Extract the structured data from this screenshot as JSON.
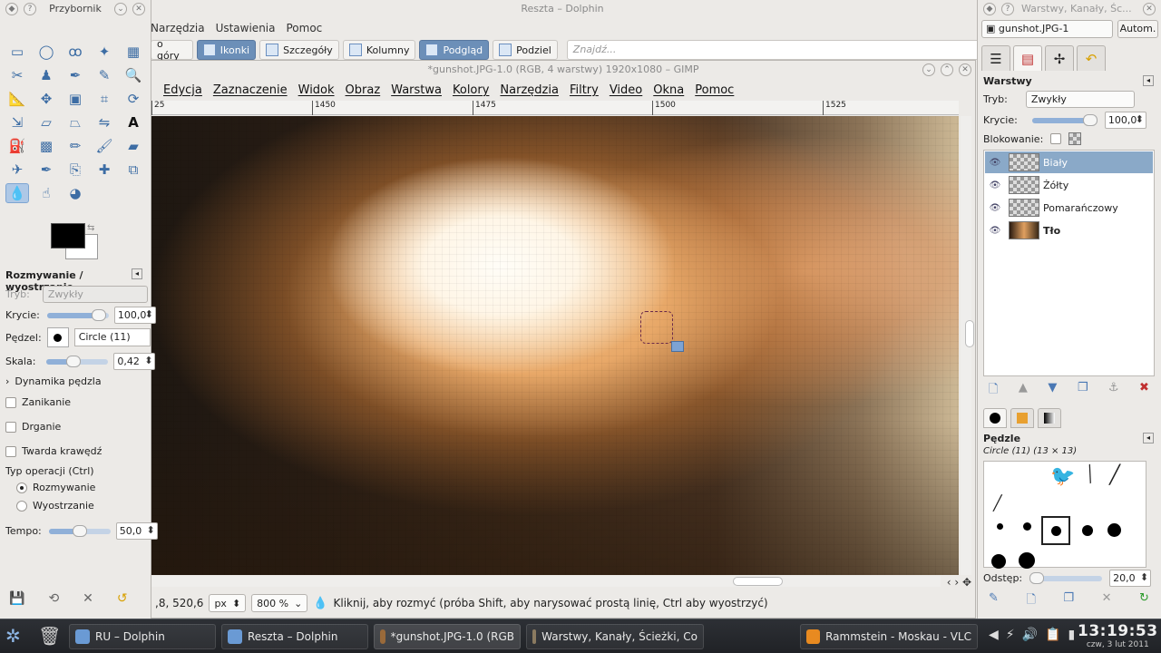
{
  "dolphin": {
    "title": "Reszta – Dolphin",
    "menu": [
      "Narzędzia",
      "Ustawienia",
      "Pomoc"
    ],
    "toolbar": {
      "up": "o góry",
      "icons": "Ikonki",
      "details": "Szczegóły",
      "columns": "Kolumny",
      "preview": "Podgląd",
      "split": "Podziel",
      "search_placeholder": "Znajdź..."
    }
  },
  "gimp": {
    "title": "*gunshot.JPG-1.0 (RGB, 4 warstwy) 1920x1080 – GIMP",
    "menu": [
      "Edycja",
      "Zaznaczenie",
      "Widok",
      "Obraz",
      "Warstwa",
      "Kolory",
      "Narzędzia",
      "Filtry",
      "Video",
      "Okna",
      "Pomoc"
    ],
    "ruler": [
      "25",
      "1450",
      "1475",
      "1500",
      "1525"
    ],
    "status": {
      "coords": ",8, 520,6",
      "unit": "px",
      "zoom": "800 %",
      "message": "Kliknij, aby rozmyć (próba Shift, aby narysować prostą linię, Ctrl aby wyostrzyć)"
    }
  },
  "toolbox": {
    "title": "Przybornik",
    "tools": [
      "rect-select",
      "ellipse-select",
      "free-select",
      "fuzzy-select",
      "color-select",
      "scissors-select",
      "foreground-select",
      "paths",
      "color-picker",
      "zoom",
      "measure",
      "move",
      "align",
      "crop",
      "rotate",
      "scale",
      "shear",
      "perspective",
      "flip",
      "text",
      "bucket-fill",
      "blend",
      "pencil",
      "paintbrush",
      "eraser",
      "airbrush",
      "ink",
      "clone",
      "heal",
      "perspective-clone",
      "blur-sharpen",
      "smudge",
      "dodge-burn"
    ],
    "options_title": "Rozmywanie / wyostrzanie",
    "mode_label": "Tryb:",
    "mode_value": "Zwykły",
    "opacity_label": "Krycie:",
    "opacity_value": "100,0",
    "brush_label": "Pędzel:",
    "brush_value": "Circle (11)",
    "scale_label": "Skala:",
    "scale_value": "0,42",
    "dynamics": "Dynamika pędzla",
    "fade": "Zanikanie",
    "jitter": "Drganie",
    "hard_edge": "Twarda krawędź",
    "op_type": "Typ operacji  (Ctrl)",
    "blur": "Rozmywanie",
    "sharpen": "Wyostrzanie",
    "rate_label": "Tempo:",
    "rate_value": "50,0",
    "opacity_level": 0.95,
    "scale_level": 0.42,
    "rate_level": 0.5
  },
  "dock": {
    "title": "Warstwy, Kanały, Śc...",
    "image": "gunshot.JPG-1",
    "auto": "Autom.",
    "layers_title": "Warstwy",
    "mode_label": "Tryb:",
    "mode_value": "Zwykły",
    "opacity_label": "Krycie:",
    "opacity_value": "100,0",
    "lock_label": "Blokowanie:",
    "layers": [
      "Biały",
      "Żółty",
      "Pomarańczowy",
      "Tło"
    ],
    "brushes_title": "Pędzle",
    "brush_info": "Circle (11) (13 × 13)",
    "spacing_label": "Odstęp:",
    "spacing_value": "20,0"
  },
  "taskbar": {
    "tasks": [
      "RU – Dolphin",
      "Reszta – Dolphin",
      "*gunshot.JPG-1.0 (RGB",
      "Warstwy, Kanały, Ścieżki, Co",
      "Rammstein - Moskau - VLC"
    ],
    "time": "13:19:53",
    "date": "czw, 3 lut 2011"
  }
}
